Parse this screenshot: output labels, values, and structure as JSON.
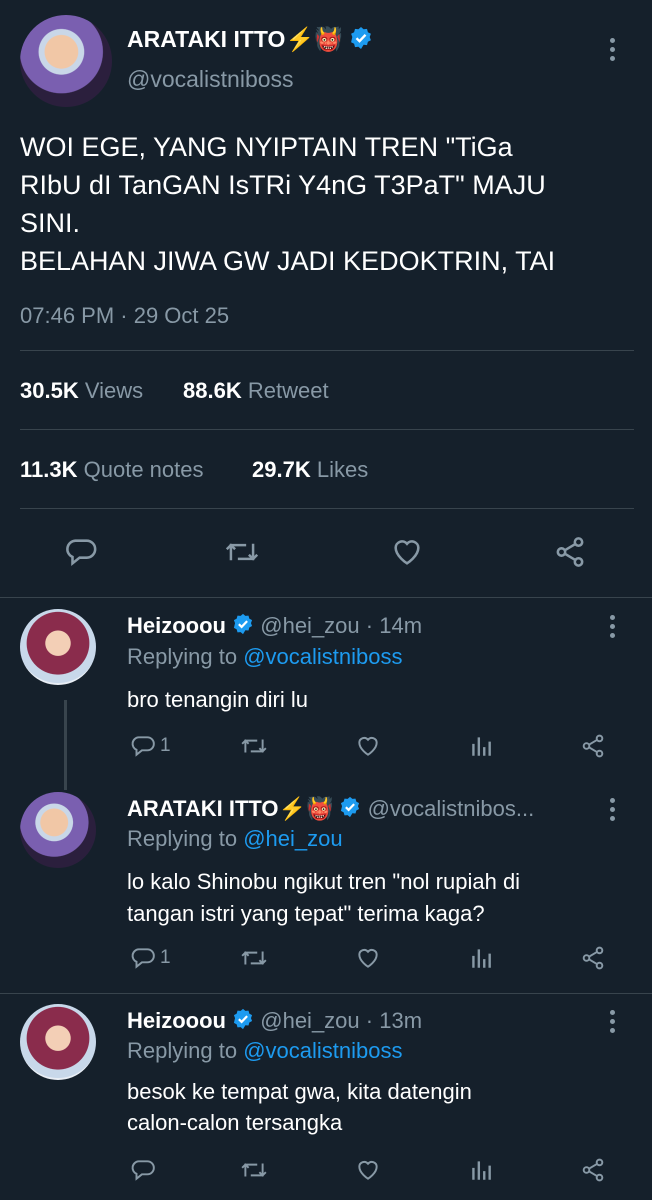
{
  "main_tweet": {
    "author_name": "ARATAKI ITTO",
    "author_emoji": "⚡👹",
    "handle": "@vocalistniboss",
    "text_lines": [
      "WOI EGE, YANG NYIPTAIN TREN \"TiGa",
      "RIbU dI TanGAN IsTRi Y4nG T3PaT\" MAJU",
      "SINI.",
      "BELAHAN JIWA GW JADI KEDOKTRIN, TAI"
    ],
    "timestamp": "07:46 PM · 29 Oct 25",
    "stats": {
      "views_count": "30.5K",
      "views_label": "Views",
      "retweet_count": "88.6K",
      "retweet_label": "Retweet",
      "quote_count": "11.3K",
      "quote_label": "Quote notes",
      "likes_count": "29.7K",
      "likes_label": "Likes"
    }
  },
  "replies": [
    {
      "name": "Heizooou",
      "handle": "@hei_zou",
      "time": "· 14m",
      "replying_prefix": "Replying to ",
      "replying_to": "@vocalistniboss",
      "text_lines": [
        "bro tenangin diri lu"
      ],
      "reply_count": "1"
    },
    {
      "name": "ARATAKI ITTO",
      "name_emoji": "⚡👹",
      "handle": "@vocalistnibos...",
      "time": "",
      "replying_prefix": "Replying to ",
      "replying_to": "@hei_zou",
      "text_lines": [
        "lo kalo Shinobu ngikut tren \"nol rupiah di",
        "tangan istri yang tepat\" terima kaga?"
      ],
      "reply_count": "1"
    },
    {
      "name": "Heizooou",
      "handle": "@hei_zou",
      "time": "· 13m",
      "replying_prefix": "Replying to ",
      "replying_to": "@vocalistniboss",
      "text_lines": [
        "besok ke tempat gwa, kita datengin",
        "calon-calon tersangka"
      ],
      "reply_count": ""
    }
  ],
  "colors": {
    "background": "#15202b",
    "muted": "#8899a6",
    "link": "#1d9bf0",
    "divider": "#38444d"
  },
  "icons": [
    "verified-badge-icon",
    "more-options-icon",
    "reply-icon",
    "retweet-icon",
    "like-icon",
    "share-icon",
    "analytics-icon"
  ]
}
